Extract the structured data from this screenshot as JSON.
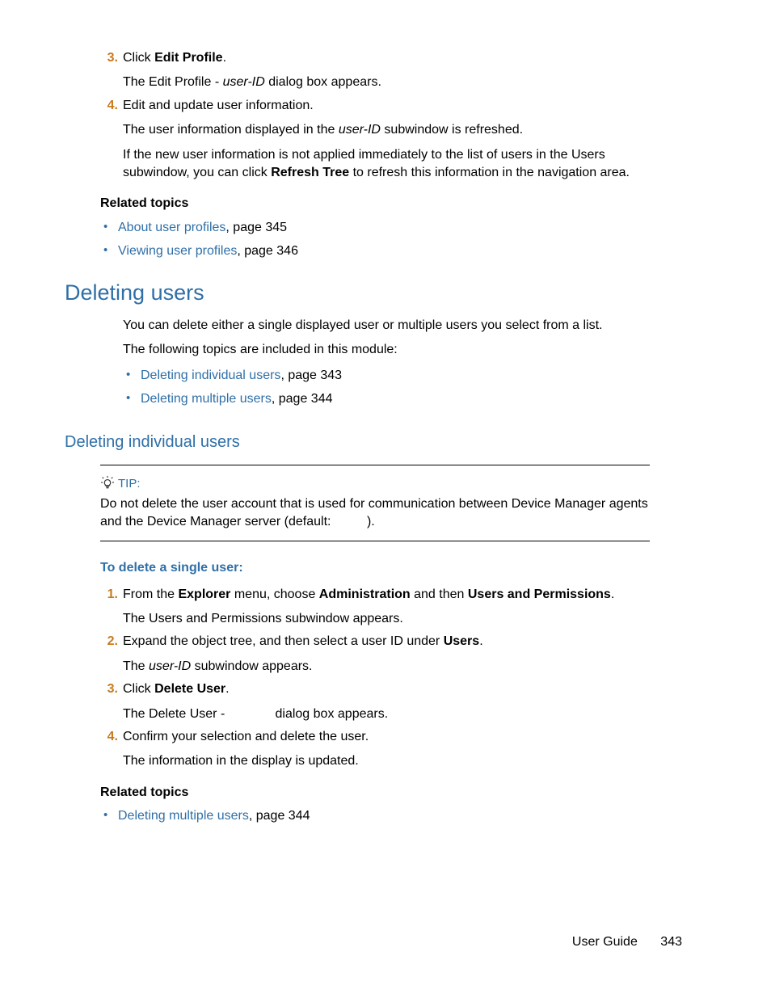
{
  "intro_steps": {
    "step3": {
      "num": "3.",
      "click": "Click ",
      "edit_profile": "Edit Profile",
      "dot": ".",
      "sub_a": "The Edit Profile - ",
      "sub_userid": "user-ID",
      "sub_b": " dialog box appears."
    },
    "step4": {
      "num": "4.",
      "text": "Edit and update user information.",
      "sub1_a": "The user information displayed in the ",
      "sub1_userid": "user-ID",
      "sub1_b": " subwindow is refreshed.",
      "sub2_a": "If the new user information is not applied immediately to the list of users in the Users subwindow, you can click ",
      "sub2_refresh": "Refresh Tree",
      "sub2_b": " to refresh this information in the navigation area."
    }
  },
  "related1": {
    "heading": "Related topics",
    "item1_link": "About user profiles",
    "item1_tail": ", page 345",
    "item2_link": "Viewing user profiles",
    "item2_tail": ", page 346"
  },
  "deleting_users": {
    "title": "Deleting users",
    "p1": "You can delete either a single displayed user or multiple users you select from a list.",
    "p2": "The following topics are included in this module:",
    "item1_link": "Deleting individual users",
    "item1_tail": ", page 343",
    "item2_link": "Deleting multiple users",
    "item2_tail": ", page 344"
  },
  "deleting_individual": {
    "title": "Deleting individual users",
    "tip_label": "TIP:",
    "tip_body": "Do not delete the user account that is used for communication between Device Manager agents and the Device Manager server (default:          ).",
    "proc_heading": "To delete a single user:",
    "step1": {
      "num": "1.",
      "a": "From the ",
      "b": "Explorer",
      "c": " menu, choose ",
      "d": "Administration",
      "e": " and then ",
      "f": "Users and Permissions",
      "g": ".",
      "sub": "The Users and Permissions subwindow appears."
    },
    "step2": {
      "num": "2.",
      "a": "Expand the object tree, and then select a user ID under ",
      "b": "Users",
      "c": ".",
      "sub_a": "The ",
      "sub_userid": "user-ID",
      "sub_b": " subwindow appears."
    },
    "step3": {
      "num": "3.",
      "a": "Click ",
      "b": "Delete User",
      "c": ".",
      "sub": "The Delete User -              dialog box appears."
    },
    "step4": {
      "num": "4.",
      "a": "Confirm your selection and delete the user.",
      "sub": "The information in the display is updated."
    }
  },
  "related2": {
    "heading": "Related topics",
    "item1_link": "Deleting multiple users",
    "item1_tail": ", page 344"
  },
  "footer": {
    "guide": "User Guide",
    "page": "343"
  }
}
